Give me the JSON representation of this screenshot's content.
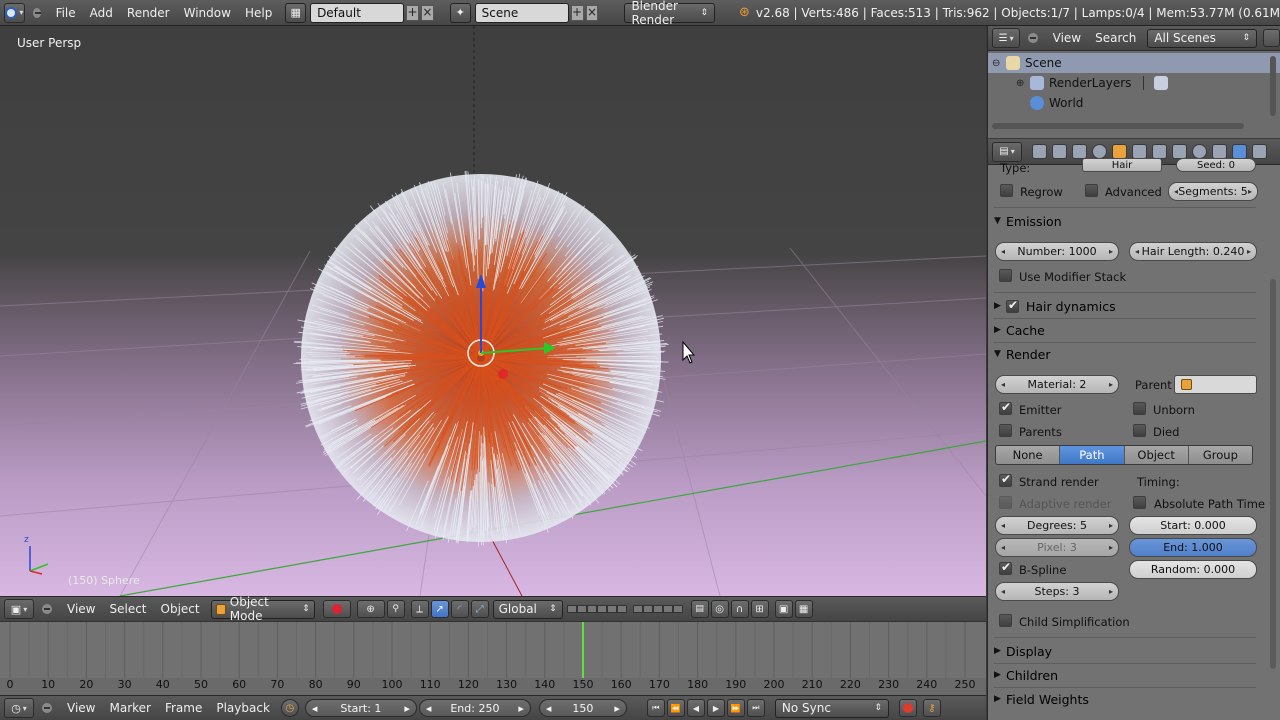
{
  "topbar": {
    "menus": [
      "File",
      "Add",
      "Render",
      "Window",
      "Help"
    ],
    "screen_layout": "Default",
    "scene": "Scene",
    "render_engine": "Blender Render",
    "stats": "v2.68 | Verts:486 | Faces:513 | Tris:962 | Objects:1/7 | Lamps:0/4 | Mem:53.77M (0.61M"
  },
  "viewport": {
    "view_label": "User Persp",
    "object_label": "(150) Sphere",
    "colors": {
      "hair_white": "#e8ecf4",
      "hair_orange": "#d8501c",
      "grid_green": "#3aa83a"
    }
  },
  "viewport_header": {
    "menus": [
      "View",
      "Select",
      "Object"
    ],
    "mode": "Object Mode",
    "orientation": "Global"
  },
  "timeline": {
    "ticks": [
      "0",
      "10",
      "20",
      "30",
      "40",
      "50",
      "60",
      "70",
      "80",
      "90",
      "100",
      "110",
      "120",
      "130",
      "140",
      "150",
      "160",
      "170",
      "180",
      "190",
      "200",
      "210",
      "220",
      "230",
      "240",
      "250"
    ],
    "current_frame_marker": 150,
    "menus": [
      "View",
      "Marker",
      "Frame",
      "Playback"
    ],
    "start": "Start: 1",
    "end": "End: 250",
    "current": "150",
    "sync": "No Sync"
  },
  "outliner": {
    "menus": [
      "View",
      "Search"
    ],
    "filter": "All Scenes",
    "rows": [
      "Scene",
      "RenderLayers",
      "World"
    ]
  },
  "properties": {
    "top_cut": {
      "type_label": "Type:",
      "type_value": "Hair",
      "seed": "Seed: 0"
    },
    "regrow": "Regrow",
    "advanced": "Advanced",
    "segments": "Segments: 5",
    "emission": {
      "title": "Emission",
      "number": "Number: 1000",
      "hair_length": "Hair Length: 0.240",
      "use_modifier_stack": "Use Modifier Stack"
    },
    "hair_dynamics": "Hair dynamics",
    "cache": "Cache",
    "render": {
      "title": "Render",
      "material": "Material: 2",
      "parent_label": "Parent",
      "emitter": "Emitter",
      "unborn": "Unborn",
      "parents": "Parents",
      "died": "Died",
      "tabs": [
        "None",
        "Path",
        "Object",
        "Group"
      ],
      "active_tab": "Path",
      "strand_render": "Strand render",
      "timing": "Timing:",
      "adaptive_render": "Adaptive render",
      "absolute_path_time": "Absolute Path Time",
      "degrees": "Degrees: 5",
      "start": "Start: 0.000",
      "pixel": "Pixel: 3",
      "end": "End: 1.000",
      "bspline": "B-Spline",
      "random": "Random: 0.000",
      "steps": "Steps: 3",
      "child_simplification": "Child Simplification"
    },
    "display": "Display",
    "children": "Children",
    "field_weights": "Field Weights"
  }
}
